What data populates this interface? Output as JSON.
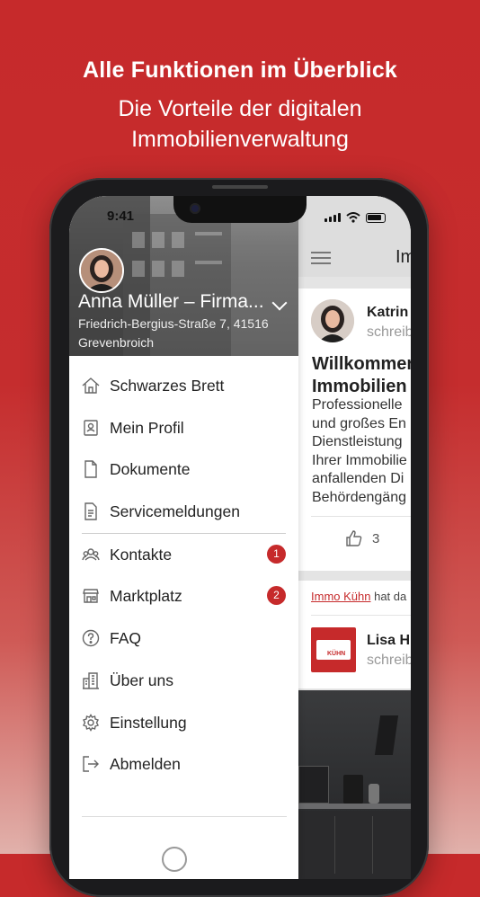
{
  "hero": {
    "title": "Alle Funktionen im Überblick",
    "subtitle_line1": "Die Vorteile der digitalen",
    "subtitle_line2": "Immobilienverwaltung"
  },
  "status_bar": {
    "time": "9:41"
  },
  "drawer": {
    "user_name": "Anna Müller – Firma...",
    "address_line1": "Friedrich-Bergius-Straße 7, 41516",
    "address_line2": "Grevenbroich",
    "menu_group1": [
      {
        "label": "Schwarzes Brett",
        "icon": "home-icon"
      },
      {
        "label": "Mein Profil",
        "icon": "id-card-icon"
      },
      {
        "label": "Dokumente",
        "icon": "document-icon"
      },
      {
        "label": "Servicemeldungen",
        "icon": "report-icon"
      }
    ],
    "menu_group2": [
      {
        "label": "Kontakte",
        "icon": "contacts-icon",
        "badge": "1"
      },
      {
        "label": "Marktplatz",
        "icon": "store-icon",
        "badge": "2"
      },
      {
        "label": "FAQ",
        "icon": "help-icon"
      },
      {
        "label": "Über uns",
        "icon": "building-icon"
      },
      {
        "label": "Einstellung",
        "icon": "gear-icon"
      },
      {
        "label": "Abmelden",
        "icon": "logout-icon"
      }
    ]
  },
  "feed": {
    "header_title": "Im",
    "post": {
      "author": "Katrin",
      "meta": "schreib",
      "headline_line1": "Willkommen",
      "headline_line2": "Immobilien",
      "body_lines": [
        "Professionelle",
        "und großes En",
        "Dienstleistung",
        "Ihrer Immobilie",
        "anfallenden Di",
        "Behördengäng"
      ],
      "likes": "3"
    },
    "activity": {
      "link_text": "Immo Kühn",
      "text": " hat da",
      "author": "Lisa H",
      "meta": "schreib",
      "logo_text": "KÜHN"
    }
  },
  "colors": {
    "brand": "#c62a2b"
  }
}
